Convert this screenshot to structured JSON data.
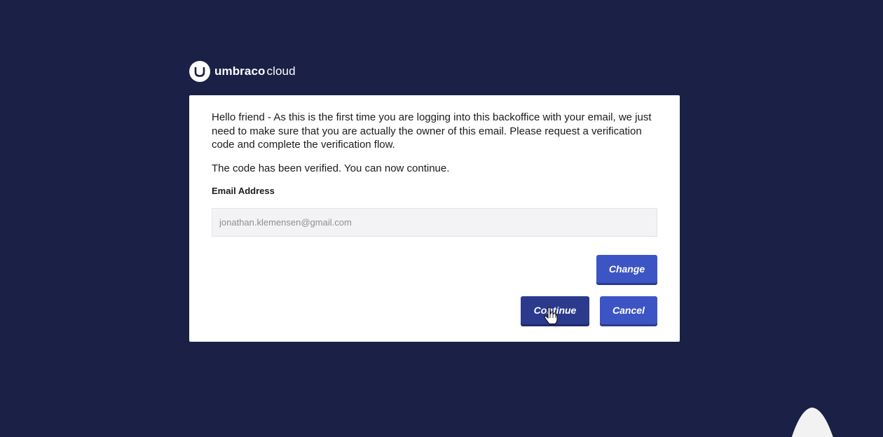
{
  "brand": {
    "name_bold": "umbraco",
    "name_light": "cloud",
    "logo_icon": "umbraco-u-icon"
  },
  "dialog": {
    "intro_text": "Hello friend - As this is the first time you are logging into this backoffice with your email, we just need to make sure that you are actually the owner of this email. Please request a verification code and complete the verification flow.",
    "status_text": "The code has been verified. You can now continue.",
    "email_label": "Email Address",
    "email_value": "jonathan.klemensen@gmail.com",
    "change_label": "Change",
    "continue_label": "Continue",
    "cancel_label": "Cancel"
  },
  "colors": {
    "background": "#1a2046",
    "primary_button": "#3d55c4",
    "focused_button": "#2b3a8c",
    "input_background": "#f3f3f5"
  }
}
